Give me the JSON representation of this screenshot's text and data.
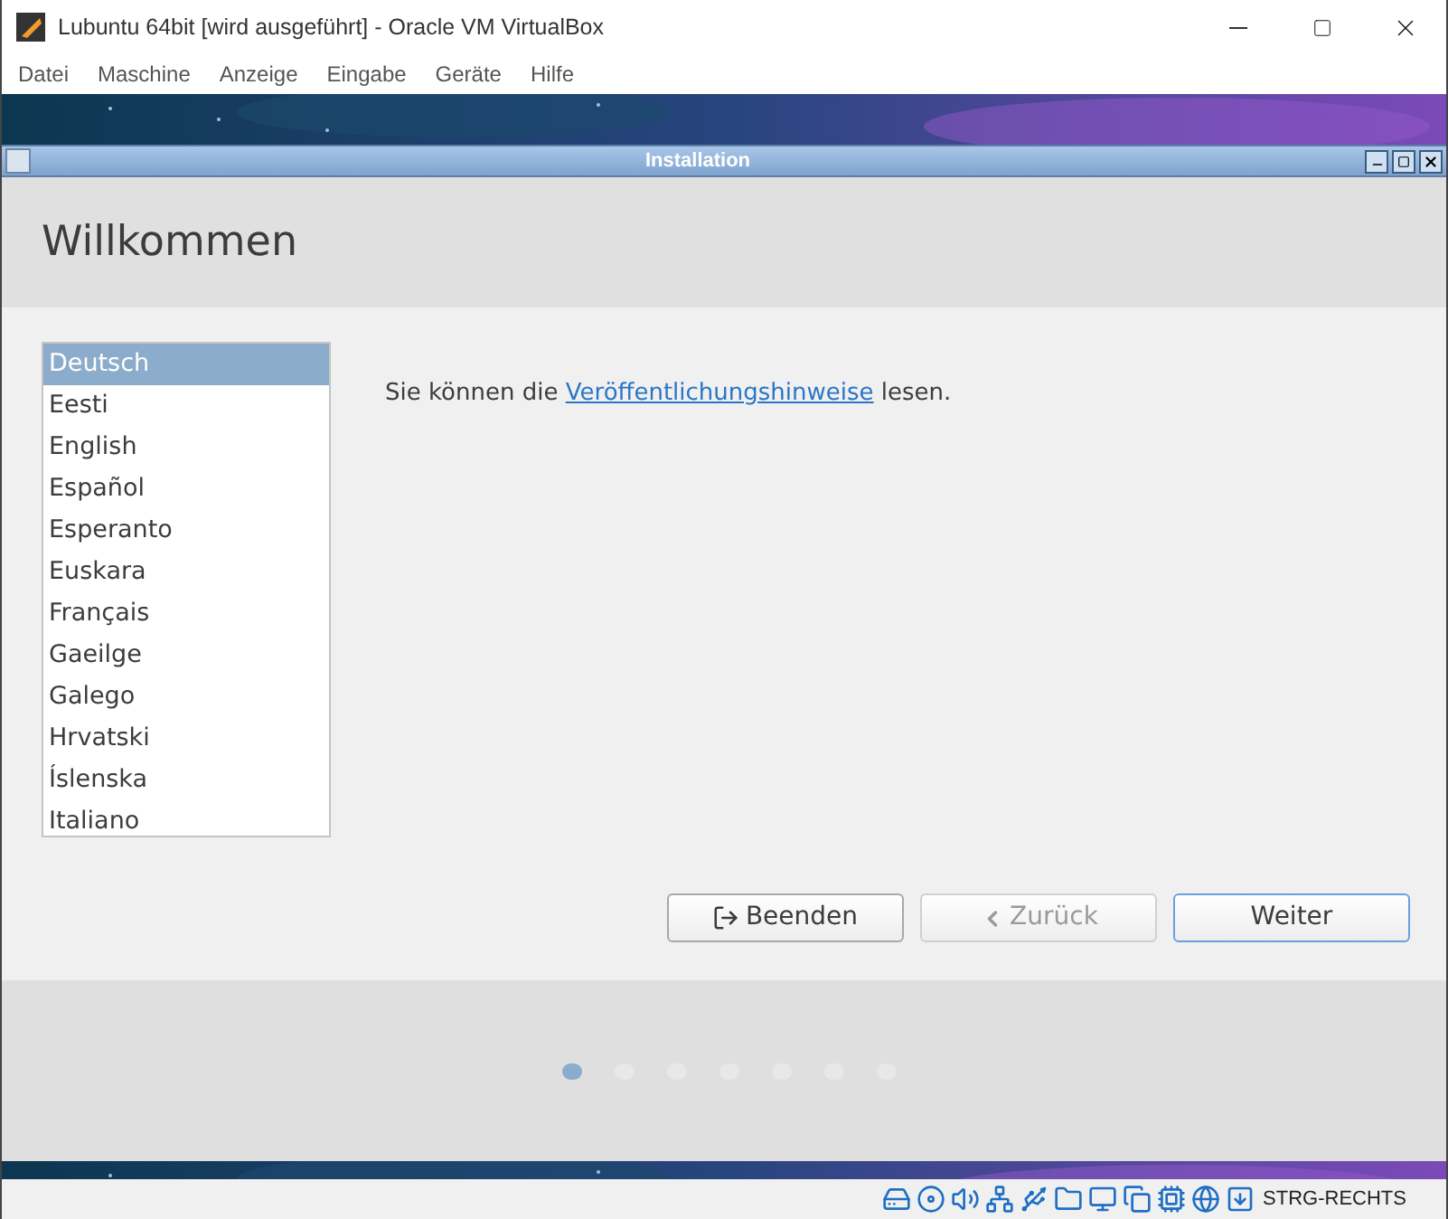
{
  "window": {
    "title": "Lubuntu 64bit [wird ausgeführt] - Oracle VM VirtualBox"
  },
  "menu": [
    "Datei",
    "Maschine",
    "Anzeige",
    "Eingabe",
    "Geräte",
    "Hilfe"
  ],
  "installer": {
    "title": "Installation",
    "heading": "Willkommen",
    "languages": [
      {
        "label": "Deutsch",
        "selected": true
      },
      {
        "label": "Eesti",
        "selected": false
      },
      {
        "label": "English",
        "selected": false
      },
      {
        "label": "Español",
        "selected": false
      },
      {
        "label": "Esperanto",
        "selected": false
      },
      {
        "label": "Euskara",
        "selected": false
      },
      {
        "label": "Français",
        "selected": false
      },
      {
        "label": "Gaeilge",
        "selected": false
      },
      {
        "label": "Galego",
        "selected": false
      },
      {
        "label": "Hrvatski",
        "selected": false
      },
      {
        "label": "Íslenska",
        "selected": false
      },
      {
        "label": "Italiano",
        "selected": false
      }
    ],
    "notice": {
      "before": "Sie können die",
      "link": "Veröffentlichungshinweise",
      "after": "lesen."
    },
    "buttons": [
      {
        "kind": "quit",
        "label": "Beenden",
        "disabled": false,
        "focused": false
      },
      {
        "kind": "back",
        "label": "Zurück",
        "disabled": true,
        "focused": false
      },
      {
        "kind": "next",
        "label": "Weiter",
        "disabled": false,
        "focused": true
      }
    ],
    "steps": [
      {
        "selected": true
      },
      {
        "selected": false
      },
      {
        "selected": false
      },
      {
        "selected": false
      },
      {
        "selected": false
      },
      {
        "selected": false
      },
      {
        "selected": false
      }
    ]
  },
  "status_bar": {
    "host_key": "STRG-RECHTS"
  }
}
